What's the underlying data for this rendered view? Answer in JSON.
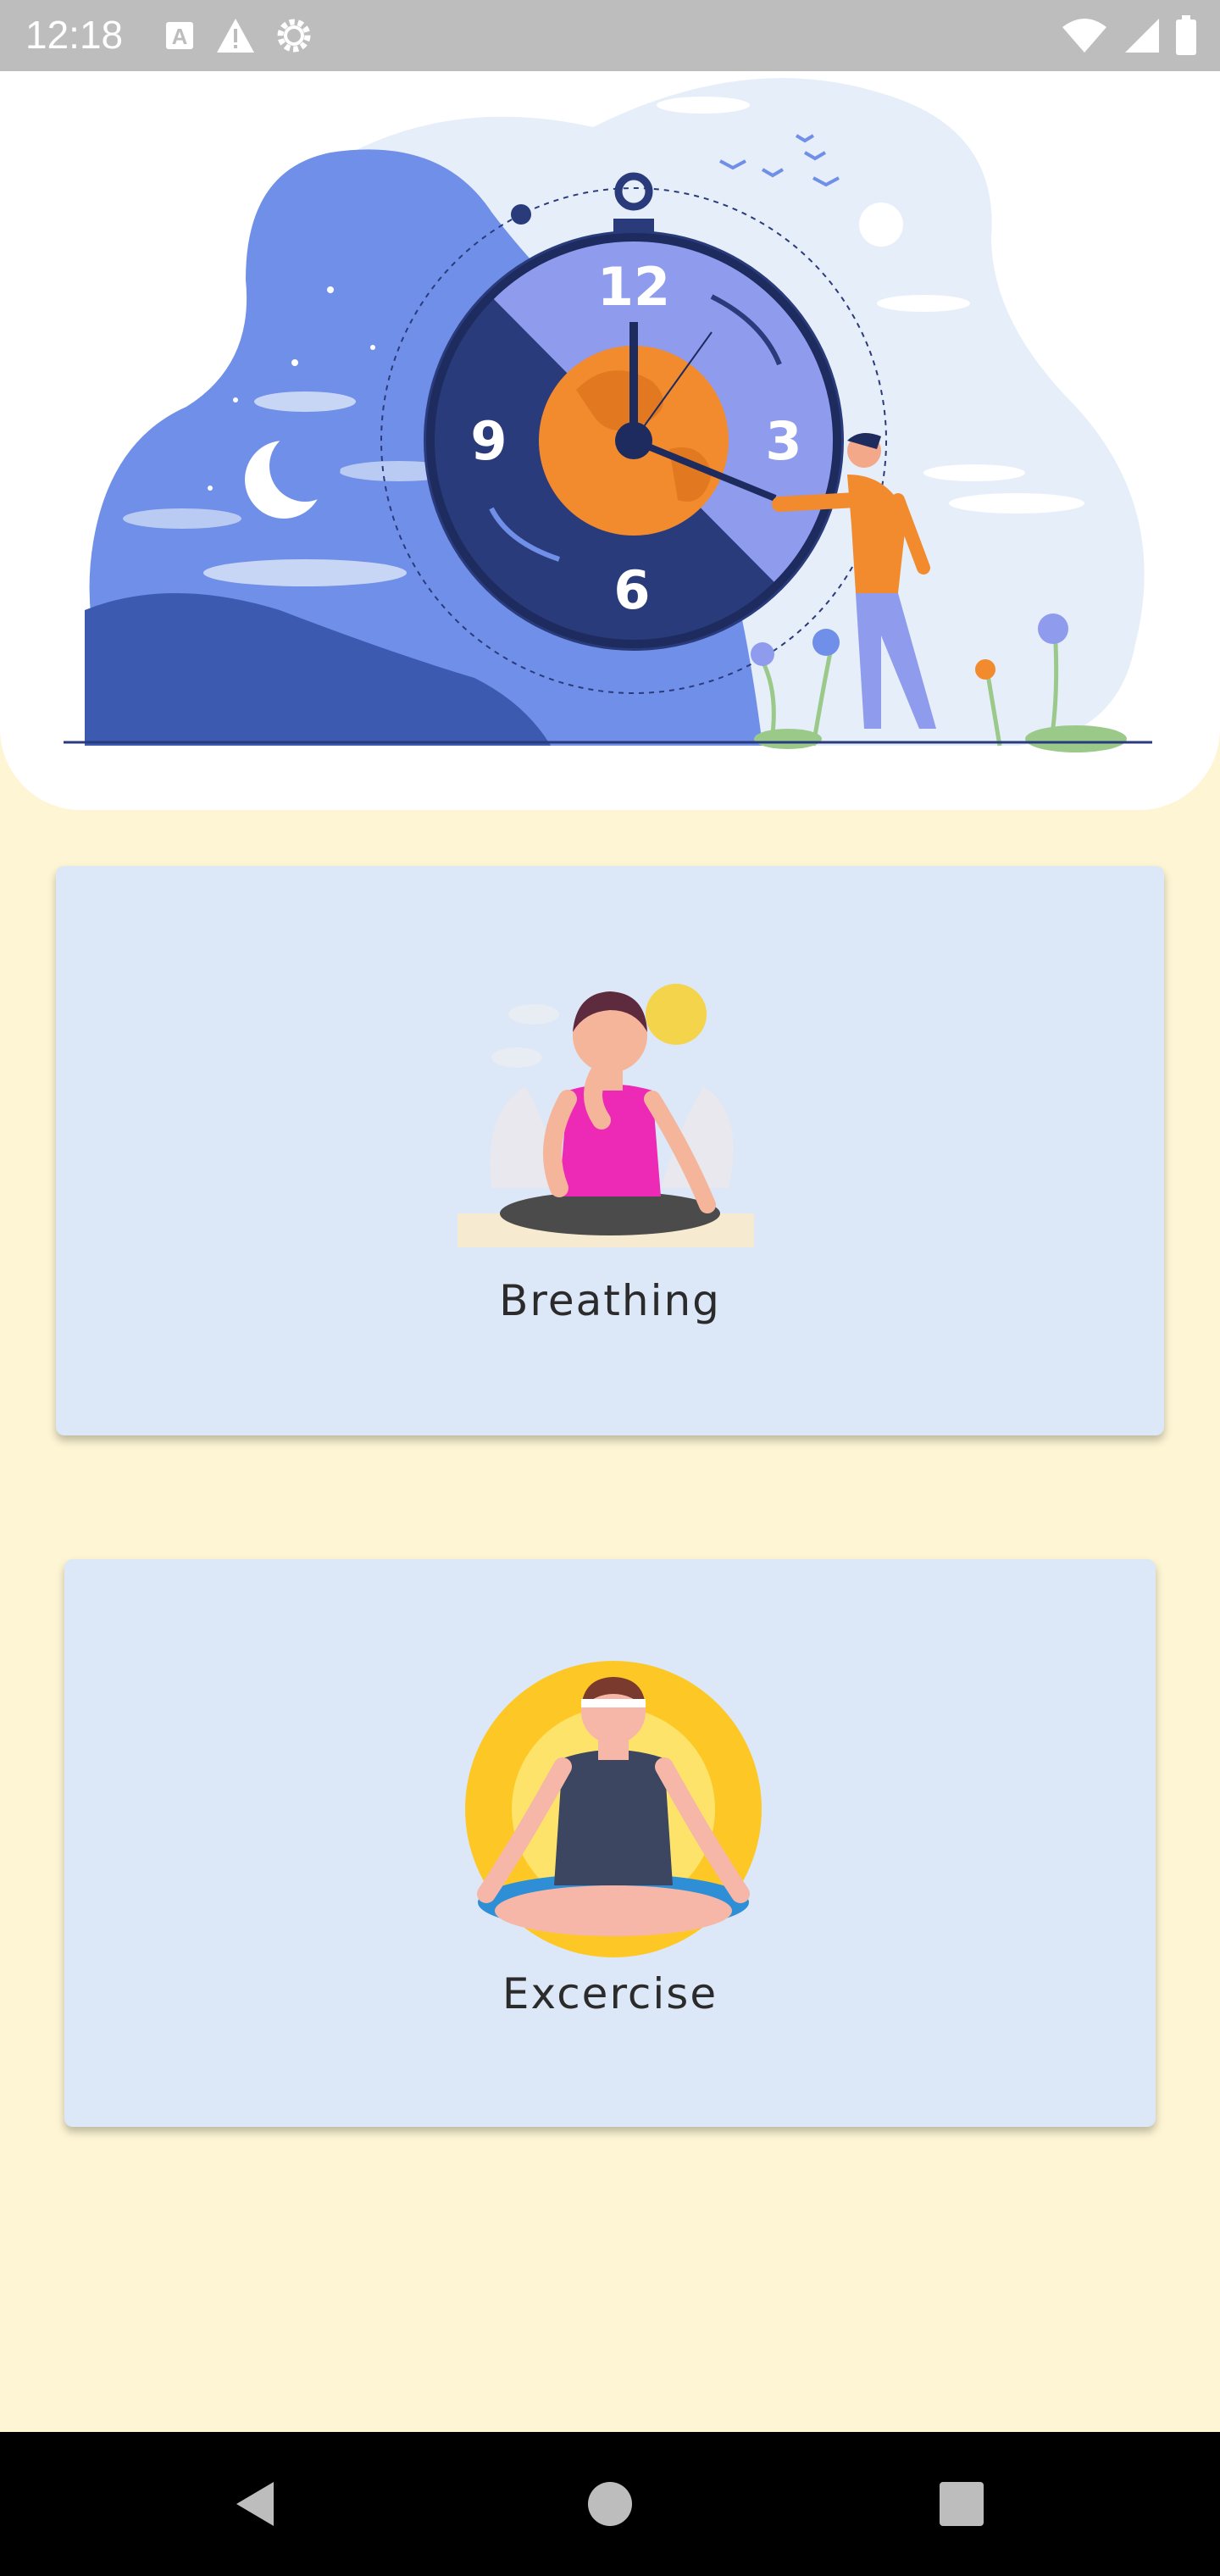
{
  "status_bar": {
    "time": "12:18",
    "left_icons": [
      "a-box-icon",
      "warning-icon",
      "gear-icon"
    ],
    "right_icons": [
      "wifi-icon",
      "signal-icon",
      "battery-icon"
    ]
  },
  "hero": {
    "illustration": "clock-illustration",
    "clock_numbers": [
      "12",
      "3",
      "6",
      "9"
    ]
  },
  "cards": [
    {
      "label": "Breathing",
      "icon": "breathing-person-icon"
    },
    {
      "label": "Excercise",
      "icon": "meditation-person-icon"
    }
  ],
  "nav": {
    "back": "back-icon",
    "home": "home-icon",
    "recents": "recents-icon"
  },
  "colors": {
    "background": "#fdf5d3",
    "card": "#dce7f7",
    "accent_blue": "#6f8fe8",
    "accent_orange": "#f28b2e",
    "dark_navy": "#2a3b7c"
  }
}
